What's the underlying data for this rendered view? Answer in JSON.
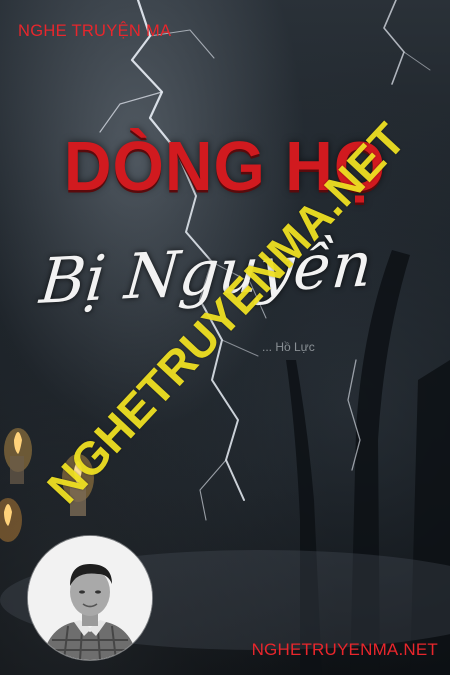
{
  "cover": {
    "brand_top": "NGHE TRUYỆN MA",
    "title_main": "DÒNG HỌ",
    "title_sub": "Bị Nguyền",
    "author": "... Hồ Lực",
    "watermark": "NGHETRUYENMA.NET",
    "brand_bottom": "NGHETRUYENMA.NET"
  },
  "colors": {
    "brand_red": "#e8262c",
    "title_red": "#d11a1f",
    "watermark_yellow": "#f5e623",
    "background": "#1b2127"
  }
}
